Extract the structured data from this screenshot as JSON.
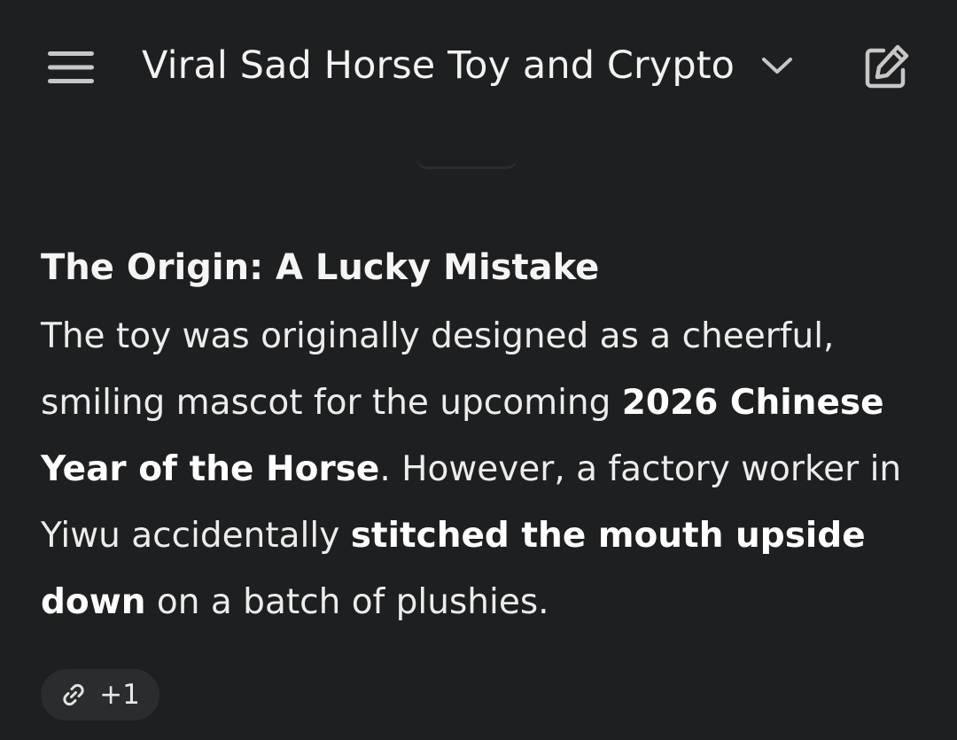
{
  "header": {
    "menu_icon": "hamburger-menu-icon",
    "title": "Viral Sad Horse Toy and Crypto",
    "title_chevron_icon": "chevron-down-icon",
    "new_chat_icon": "edit-square-icon"
  },
  "message": {
    "heading": "The Origin: A Lucky Mistake",
    "paragraph": [
      {
        "text": "The toy was originally designed as a cheerful, smiling mascot for the upcoming ",
        "bold": false
      },
      {
        "text": "2026 Chinese Year of the Horse",
        "bold": true
      },
      {
        "text": ". However, a factory worker in Yiwu accidentally ",
        "bold": false
      },
      {
        "text": "stitched the mouth upside down",
        "bold": true
      },
      {
        "text": " on a batch of plushies.",
        "bold": false
      }
    ],
    "sources_chip": {
      "icon": "link-icon",
      "label": "+1"
    }
  },
  "colors": {
    "background": "#1e1f20",
    "text": "#e3e3e3",
    "chip_background": "#2b2c2e"
  }
}
